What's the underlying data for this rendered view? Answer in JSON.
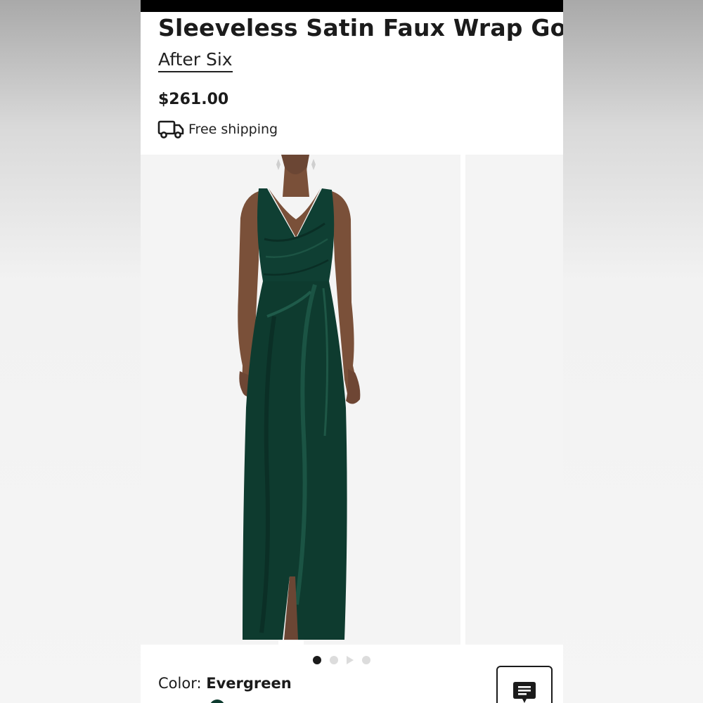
{
  "product": {
    "title": "Sleeveless Satin Faux Wrap Gown",
    "brand": "After Six",
    "price": "$261.00",
    "shipping_text": "Free shipping",
    "shipping_icon": "truck-icon"
  },
  "gallery": {
    "image_count": 4,
    "active_index": 0,
    "main_image": "model-in-evergreen-gown",
    "dress_color": "#0e3b2f"
  },
  "color": {
    "label": "Color:",
    "value": "Evergreen",
    "swatch": "#0e3b2f"
  },
  "chat": {
    "icon": "chat-icon"
  }
}
